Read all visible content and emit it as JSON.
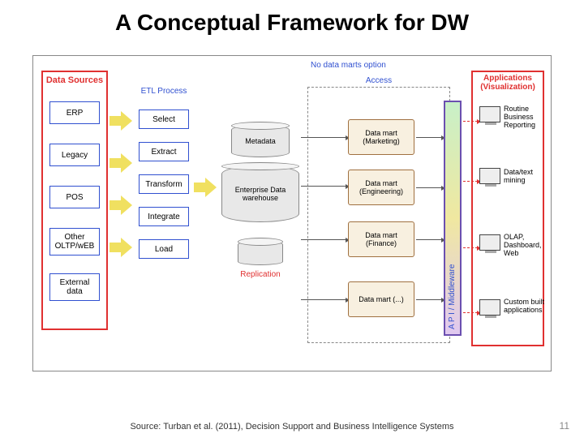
{
  "title": "A Conceptual Framework for DW",
  "footer": "Source: Turban et al. (2011), Decision Support and Business Intelligence Systems",
  "page_number": "11",
  "labels": {
    "data_sources": "Data Sources",
    "etl_process": "ETL Process",
    "access": "Access",
    "no_data_marts": "No data marts option",
    "applications": "Applications (Visualization)",
    "api": "A P I / Middleware",
    "metadata": "Metadata",
    "edw": "Enterprise Data warehouse",
    "replication": "Replication"
  },
  "sources": [
    "ERP",
    "Legacy",
    "POS",
    "Other OLTP/wEB",
    "External data"
  ],
  "etl": [
    "Select",
    "Extract",
    "Transform",
    "Integrate",
    "Load"
  ],
  "marts": [
    "Data mart (Marketing)",
    "Data mart (Engineering)",
    "Data mart (Finance)",
    "Data mart (...)"
  ],
  "apps": [
    "Routine Business Reporting",
    "Data/text mining",
    "OLAP, Dashboard, Web",
    "Custom built applications"
  ]
}
